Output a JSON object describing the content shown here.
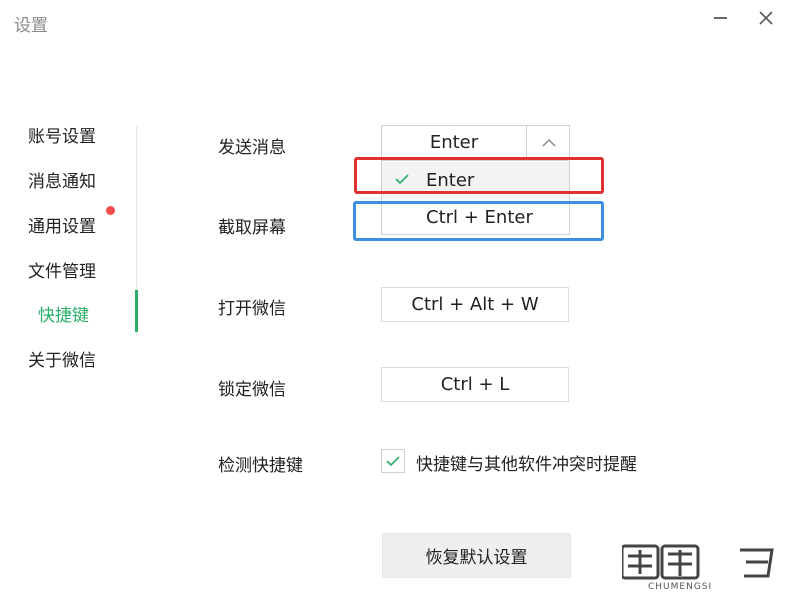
{
  "window": {
    "title": "设置"
  },
  "sidebar": {
    "items": [
      {
        "label": "账号设置"
      },
      {
        "label": "消息通知"
      },
      {
        "label": "通用设置"
      },
      {
        "label": "文件管理"
      },
      {
        "label": "快捷键"
      },
      {
        "label": "关于微信"
      }
    ],
    "active_color": "#2aae67",
    "badge_color": "#f24c4c"
  },
  "shortcuts": {
    "send_message": {
      "label": "发送消息",
      "selected": "Enter",
      "options": [
        "Enter",
        "Ctrl + Enter"
      ]
    },
    "screenshot": {
      "label": "截取屏幕"
    },
    "open_wechat": {
      "label": "打开微信",
      "value": "Ctrl + Alt + W"
    },
    "lock_wechat": {
      "label": "锁定微信",
      "value": "Ctrl + L"
    },
    "detect": {
      "label": "检测快捷键",
      "checkbox_text": "快捷键与其他软件冲突时提醒",
      "checked": true
    },
    "restore_button": "恢复默认设置"
  },
  "watermark": {
    "text": "CHUMENGSI"
  },
  "highlight_colors": {
    "red": "#e03131",
    "blue": "#3d8fe0"
  }
}
